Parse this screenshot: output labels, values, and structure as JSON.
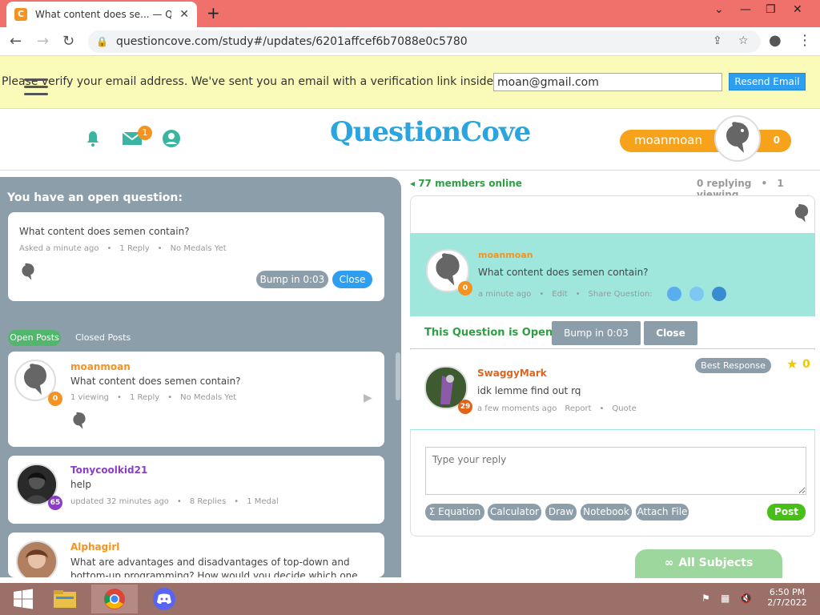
{
  "browser": {
    "tab_title": "What content does se... — Quest",
    "url": "questioncove.com/study#/updates/6201affcef6b7088e0c5780"
  },
  "banner": {
    "message": "Please verify your email address. We've sent you an email with a verification link inside.",
    "email_value": "moan@gmail.com",
    "resend_label": "Resend Email"
  },
  "header": {
    "logo_text": "QuestionCove",
    "mail_count": "1",
    "username": "moanmoan",
    "score": "0"
  },
  "left": {
    "open_question_title": "You have an open question:",
    "open_question": {
      "text": "What content does semen contain?",
      "asked": "Asked a minute ago",
      "replies": "1 Reply",
      "medals": "No Medals Yet",
      "bump_label": "Bump in 0:03",
      "close_label": "Close"
    },
    "tabs": {
      "open": "Open Posts",
      "closed": "Closed Posts"
    },
    "posts": [
      {
        "user": "moanmoan",
        "user_color": "#f39322",
        "text": "What content does semen contain?",
        "viewing": "1 viewing",
        "replies": "1 Reply",
        "medals": "No Medals Yet",
        "level": "0",
        "level_color": "#f39322"
      },
      {
        "user": "Tonycoolkid21",
        "user_color": "#8a3fc4",
        "text": "help",
        "viewing": "updated 32 minutes ago",
        "replies": "8 Replies",
        "medals": "1 Medal",
        "level": "65",
        "level_color": "#8a3fc4"
      },
      {
        "user": "Alphagirl",
        "user_color": "#f39322",
        "text": "What are advantages and disadvantages of top-down and bottom-up programming? How would you decide which one to",
        "level": "",
        "level_color": "#f39322"
      }
    ]
  },
  "right": {
    "online": "77 members online",
    "replying": "0 replying",
    "viewing": "1 viewing",
    "question": {
      "user": "moanmoan",
      "text": "What content does semen contain?",
      "time": "a minute ago",
      "edit": "Edit",
      "share": "Share Question:",
      "level": "0"
    },
    "status_text": "This Question is Open",
    "bump_label": "Bump in 0:03",
    "close_label": "Close",
    "answer": {
      "user": "SwaggyMark",
      "text": "idk lemme find out rq",
      "time": "a few moments ago",
      "report": "Report",
      "quote": "Quote",
      "best_label": "Best Response",
      "medal_count": "0",
      "level": "29"
    },
    "reply_placeholder": "Type your reply",
    "tools": [
      "Σ  Equation",
      "Calculator",
      "Draw",
      "Notebook",
      "Attach File"
    ],
    "post_label": "Post",
    "all_subjects": "All Subjects"
  },
  "taskbar": {
    "time": "6:50 PM",
    "date": "2/7/2022"
  }
}
